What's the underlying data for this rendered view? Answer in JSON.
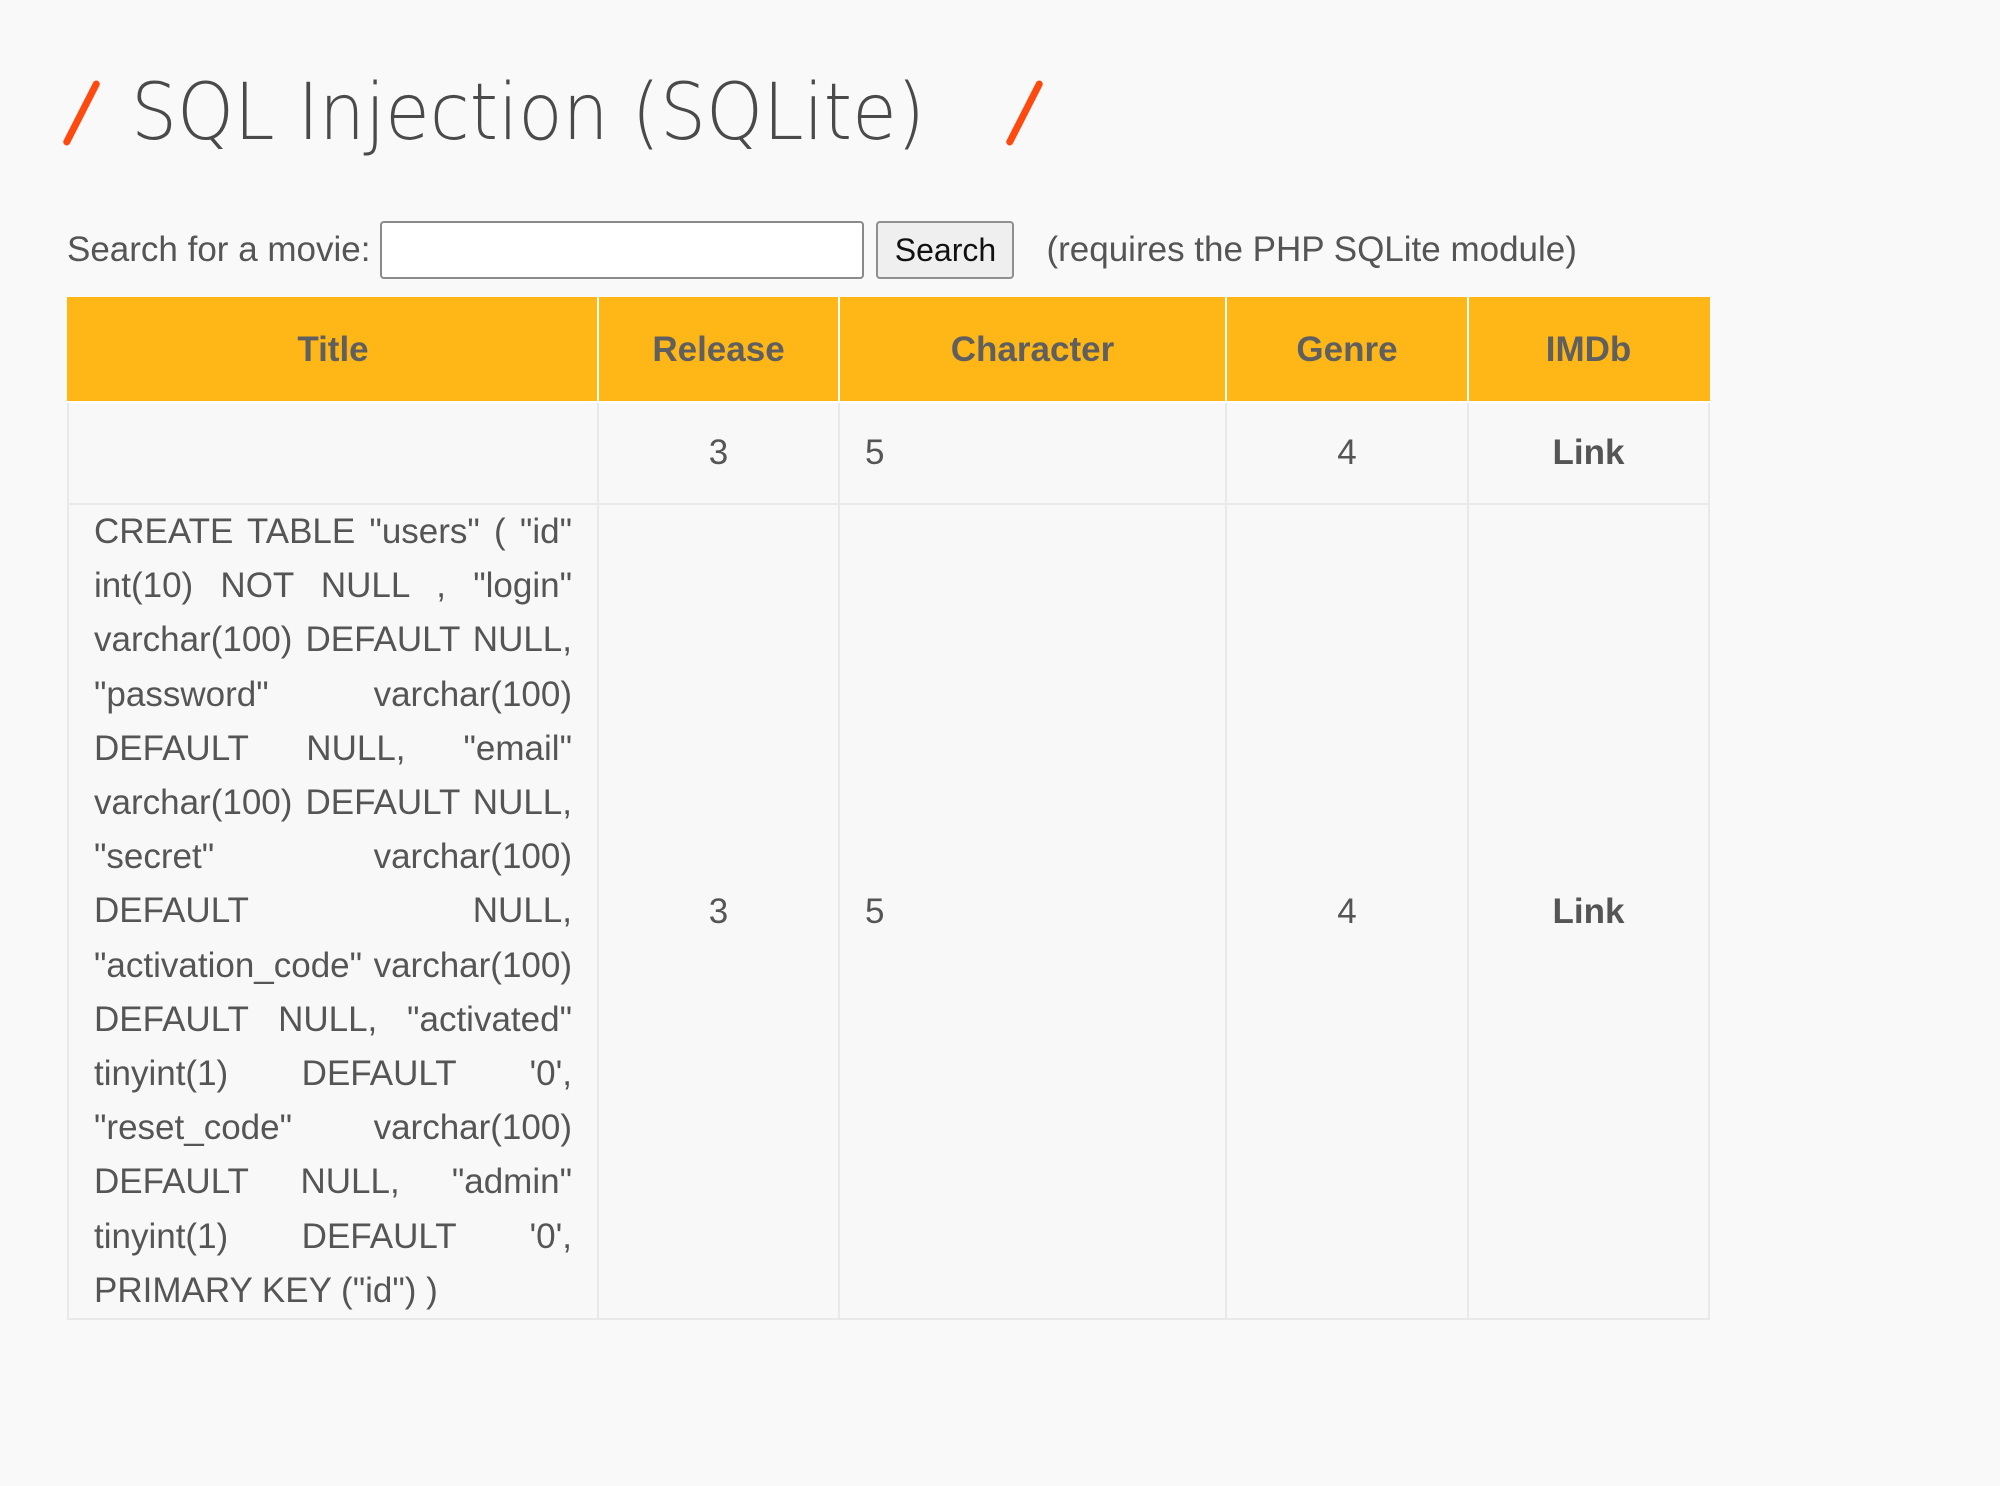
{
  "header": {
    "title": "SQL Injection (SQLite)",
    "accent_color": "#ff4a0f"
  },
  "search": {
    "label": "Search for a movie:",
    "input_value": "",
    "button_label": "Search",
    "note": "(requires the PHP SQLite module)"
  },
  "table": {
    "header_color": "#ffb717",
    "columns": [
      "Title",
      "Release",
      "Character",
      "Genre",
      "IMDb"
    ],
    "rows": [
      {
        "title": "",
        "release": "3",
        "character": "5",
        "genre": "4",
        "imdb": "Link"
      },
      {
        "title": "CREATE TABLE \"users\" ( \"id\" int(10) NOT NULL , \"login\" varchar(100) DEFAULT NULL, \"password\" varchar(100) DEFAULT NULL, \"email\" varchar(100) DEFAULT NULL, \"secret\" varchar(100) DEFAULT NULL, \"activation_code\" varchar(100) DEFAULT NULL, \"activated\" tinyint(1) DEFAULT '0', \"reset_code\" varchar(100) DEFAULT NULL, \"admin\" tinyint(1) DEFAULT '0', PRIMARY KEY (\"id\") )",
        "release": "3",
        "character": "5",
        "genre": "4",
        "imdb": "Link"
      }
    ]
  }
}
